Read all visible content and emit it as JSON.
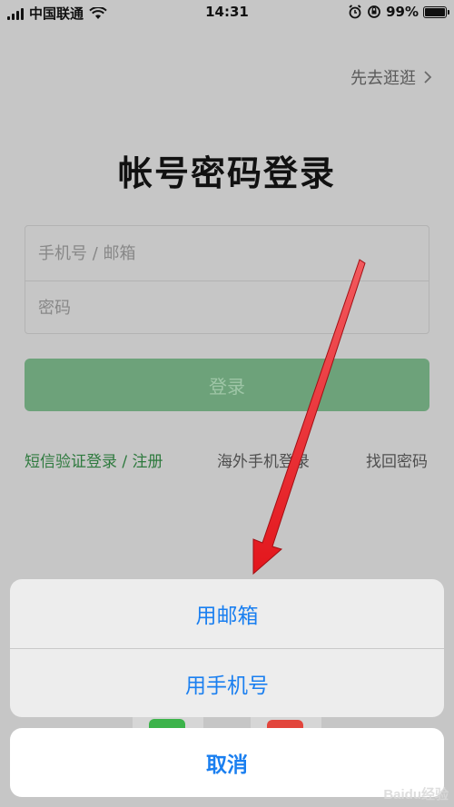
{
  "status_bar": {
    "carrier": "中国联通",
    "time": "14:31",
    "battery": "99%",
    "battery_level": 0.99
  },
  "header": {
    "browse_label": "先去逛逛",
    "browse_icon": "chevron-right-icon"
  },
  "title": "帐号密码登录",
  "form": {
    "account_placeholder": "手机号 / 邮箱",
    "password_placeholder": "密码",
    "login_label": "登录"
  },
  "links": {
    "sms_login": "短信验证登录 / 注册",
    "overseas_login": "海外手机登录",
    "forgot_password": "找回密码"
  },
  "action_sheet": {
    "options": [
      {
        "label": "用邮箱"
      },
      {
        "label": "用手机号"
      }
    ],
    "cancel_label": "取消"
  },
  "watermark": "Baidu经验",
  "colors": {
    "accent": "#1a7ff0",
    "brand_green": "#2e7a3e",
    "button_green": "#6da27a",
    "arrow_red": "#e8141b"
  }
}
